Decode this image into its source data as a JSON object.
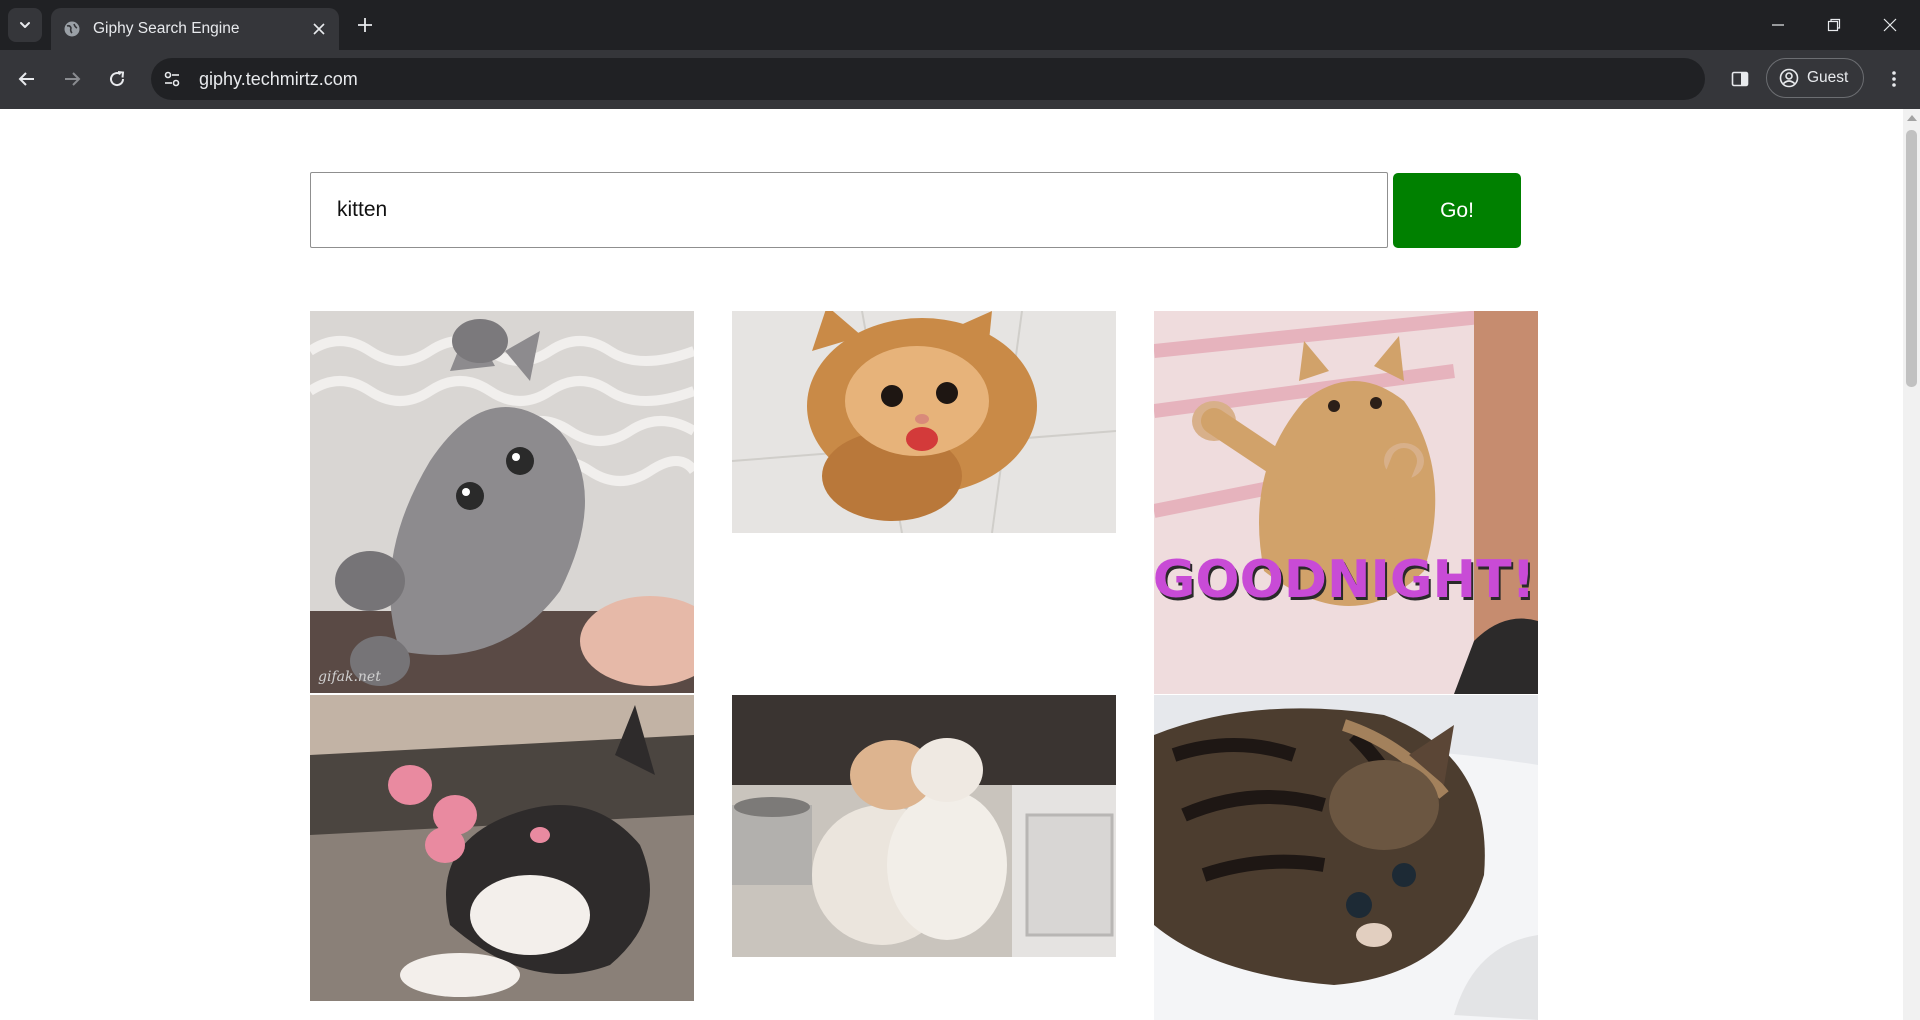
{
  "browser": {
    "tab_title": "Giphy Search Engine",
    "url": "giphy.techmirtz.com",
    "profile_label": "Guest"
  },
  "search": {
    "value": "kitten",
    "button_label": "Go!"
  },
  "results": [
    {
      "subject": "grey kitten on its back pawing",
      "watermark": "gifak.net"
    },
    {
      "subject": "orange kitten meowing on tiled floor"
    },
    {
      "subject": "orange tabby kitten stretching on pink blanket",
      "caption": "GOODNIGHT!"
    },
    {
      "subject": "black and white kitten with pink toe beans"
    },
    {
      "subject": "two fluffy kittens hugging by litter box"
    },
    {
      "subject": "tabby kitten curled up sleeping"
    }
  ],
  "colors": {
    "go_button": "#008000",
    "chrome_dark": "#202124",
    "chrome_toolbar": "#35363a"
  }
}
